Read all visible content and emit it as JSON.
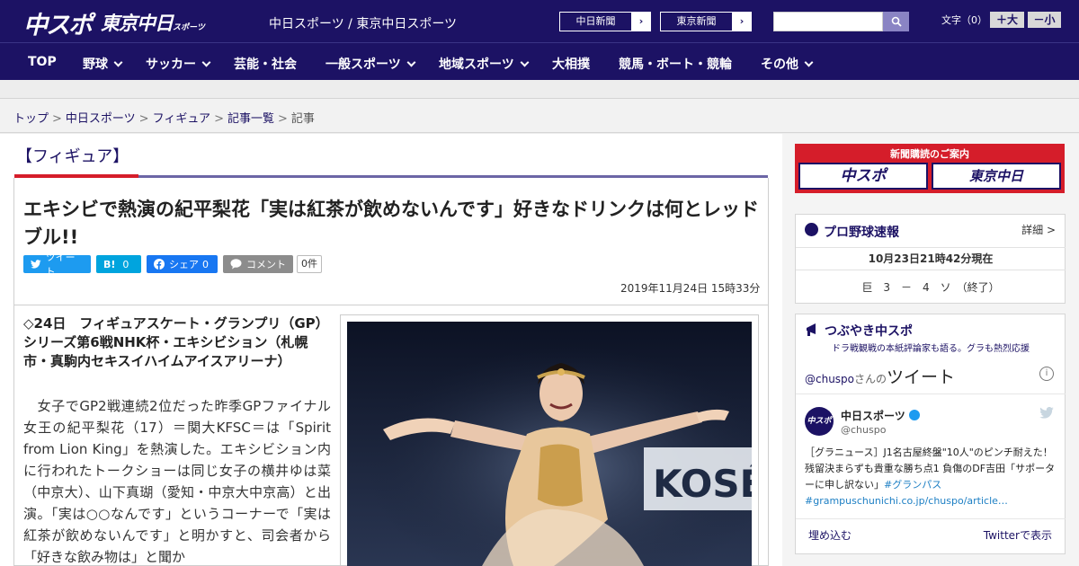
{
  "header": {
    "logo_chuspo": "中スポ",
    "logo_tokyo": "東京中日",
    "logo_tokyo_suffix": "スポーツ",
    "site_name": "中日スポーツ / 東京中日スポーツ",
    "paper_links": [
      {
        "label": "中日新聞",
        "arrow": "›"
      },
      {
        "label": "東京新聞",
        "arrow": "›"
      }
    ],
    "search_placeholder": "",
    "font_size": {
      "label": "文字（0）",
      "larger": "＋大",
      "smaller": "－小"
    },
    "search_icon": "search-icon"
  },
  "nav": {
    "items": [
      {
        "label": "TOP"
      },
      {
        "label": "野球"
      },
      {
        "label": "サッカー"
      },
      {
        "label": "芸能・社会"
      },
      {
        "label": "一般スポーツ"
      },
      {
        "label": "地域スポーツ"
      },
      {
        "label": "大相撲"
      },
      {
        "label": "競馬・ボート・競輪"
      },
      {
        "label": "その他"
      }
    ]
  },
  "breadcrumb": {
    "items": [
      "トップ",
      "中日スポーツ",
      "フィギュア",
      "記事一覧"
    ],
    "current": "記事",
    "separator": ">"
  },
  "article": {
    "section": "【フィギュア】",
    "headline": "エキシビで熱演の紀平梨花「実は紅茶が飲めないんです」好きなドリンクは何とレッドブル!!",
    "share": {
      "tweet": "ツイート",
      "hatena_label": "B!",
      "hatena_count": "0",
      "facebook": "シェア",
      "facebook_count": "0",
      "comment": "コメント",
      "comment_count": "0件"
    },
    "date": "2019年11月24日 15時33分",
    "lead": "◇24日　フィギュアスケート・グランプリ（GP）シリーズ第6戦NHK杯・エキシビション（札幌市・真駒内セキスイハイムアイスアリーナ）",
    "body": "　女子でGP2戦連続2位だった昨季GPファイナル女王の紀平梨花（17）＝関大KFSC＝は「Spirit from Lion King」を熱演した。エキシビション内に行われたトークショーは同じ女子の横井ゆは菜（中京大）、山下真瑚（愛知・中京大中京高）と出演。「実は○○なんです」というコーナーで「実は紅茶が飲めないんです」と明かすと、司会者から「好きな飲み物は」と聞か",
    "photo_banner_text": "KOSÉ"
  },
  "sidebar": {
    "subscription": {
      "title": "新聞購読のご案内",
      "logo_left": "中スポ",
      "logo_right": "東京中日"
    },
    "baseball": {
      "title": "プロ野球速報",
      "detail": "詳細 >",
      "updated": "10月23日21時42分現在",
      "score": "巨　3　－　4　ソ　（終了）"
    },
    "twitter": {
      "title": "つぶやき中スポ",
      "subtitle": "ドラ戦観戦の本紙評論家も語る。グラも熱烈応援",
      "handle_prefix": "@chuspo",
      "handle_suffix": "さんの",
      "tweets_word": "ツイート",
      "info": "i",
      "account_name": "中日スポーツ",
      "account_handle": "@chuspo",
      "avatar_text": "中スポ",
      "tweet_text": "［グラニュース］J1名古屋終盤\"10人\"のピンチ耐えた！残留決まらずも貴重な勝ち点1 負傷のDF吉田「サポーターに申し訳ない」",
      "tweet_hashtag": "#グランパス",
      "tweet_link": "#grampuschunichi.co.jp/chuspo/article…",
      "embed": "埋め込む",
      "view_on": "Twitterで表示"
    }
  },
  "colors": {
    "navy": "#1c1264",
    "red": "#d51d2a",
    "twitter": "#1d9bf0",
    "hatena": "#00a4de",
    "facebook": "#1877f2",
    "comment": "#8c8c8c"
  }
}
